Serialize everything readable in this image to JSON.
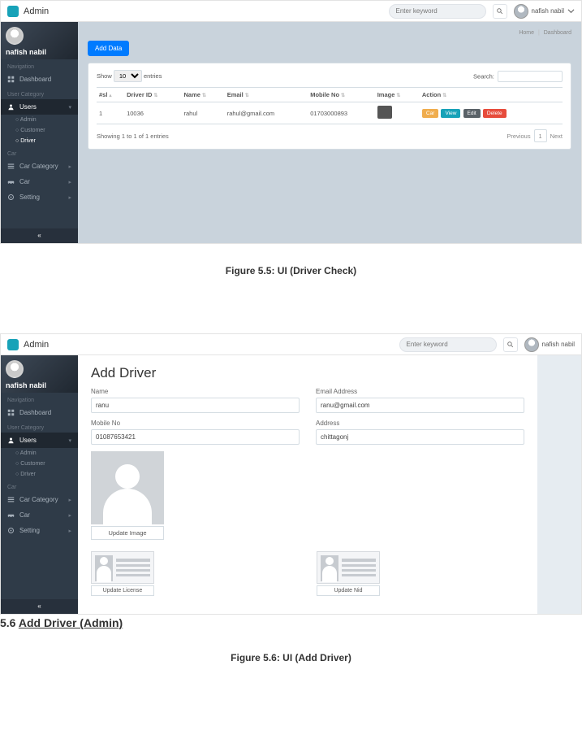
{
  "brand": "Admin",
  "header": {
    "search_placeholder": "Enter keyword",
    "username": "nafish nabil"
  },
  "sidebar": {
    "username": "nafish nabil",
    "sec_nav": "Navigation",
    "dashboard": "Dashboard",
    "sec_user_cat": "User Category",
    "users": "Users",
    "admin": "Admin",
    "customer": "Customer",
    "driver": "Driver",
    "sec_car": "Car",
    "car_category": "Car Category",
    "car": "Car",
    "setting": "Setting",
    "collapse_icon": "«"
  },
  "breadcrumb": {
    "home": "Home",
    "dash": "Dashboard"
  },
  "addBtn": "Add Data",
  "table": {
    "show_pre": "Show",
    "show_val": "10",
    "show_suf": "entries",
    "search_lbl": "Search:",
    "cols": {
      "sl": "#sl",
      "did": "Driver ID",
      "name": "Name",
      "email": "Email",
      "mob": "Mobile No",
      "img": "Image",
      "act": "Action"
    },
    "row": {
      "sl": "1",
      "did": "10036",
      "name": "rahul",
      "email": "rahul@gmail.com",
      "mob": "01703000893",
      "car": "Car",
      "view": "View",
      "edit": "Edit",
      "del": "Delete"
    },
    "info": "Showing 1 to 1 of 1 entries",
    "prev": "Previous",
    "next": "Next",
    "page": "1"
  },
  "fig1": "Figure 5.5: UI (Driver Check)",
  "addDriver": {
    "title": "Add Driver",
    "name_lbl": "Name",
    "name_val": "ranu",
    "email_lbl": "Email Address",
    "email_val": "ranu@gmail.com",
    "mob_lbl": "Mobile No",
    "mob_val": "01087653421",
    "addr_lbl": "Address",
    "addr_val": "chittagonj",
    "update_image": "Update Image",
    "update_license": "Update License",
    "update_nid": "Update Nid"
  },
  "sec_heading_pre": "5.6 ",
  "sec_heading": "Add Driver (Admin)",
  "fig2": "Figure 5.6: UI (Add Driver)"
}
